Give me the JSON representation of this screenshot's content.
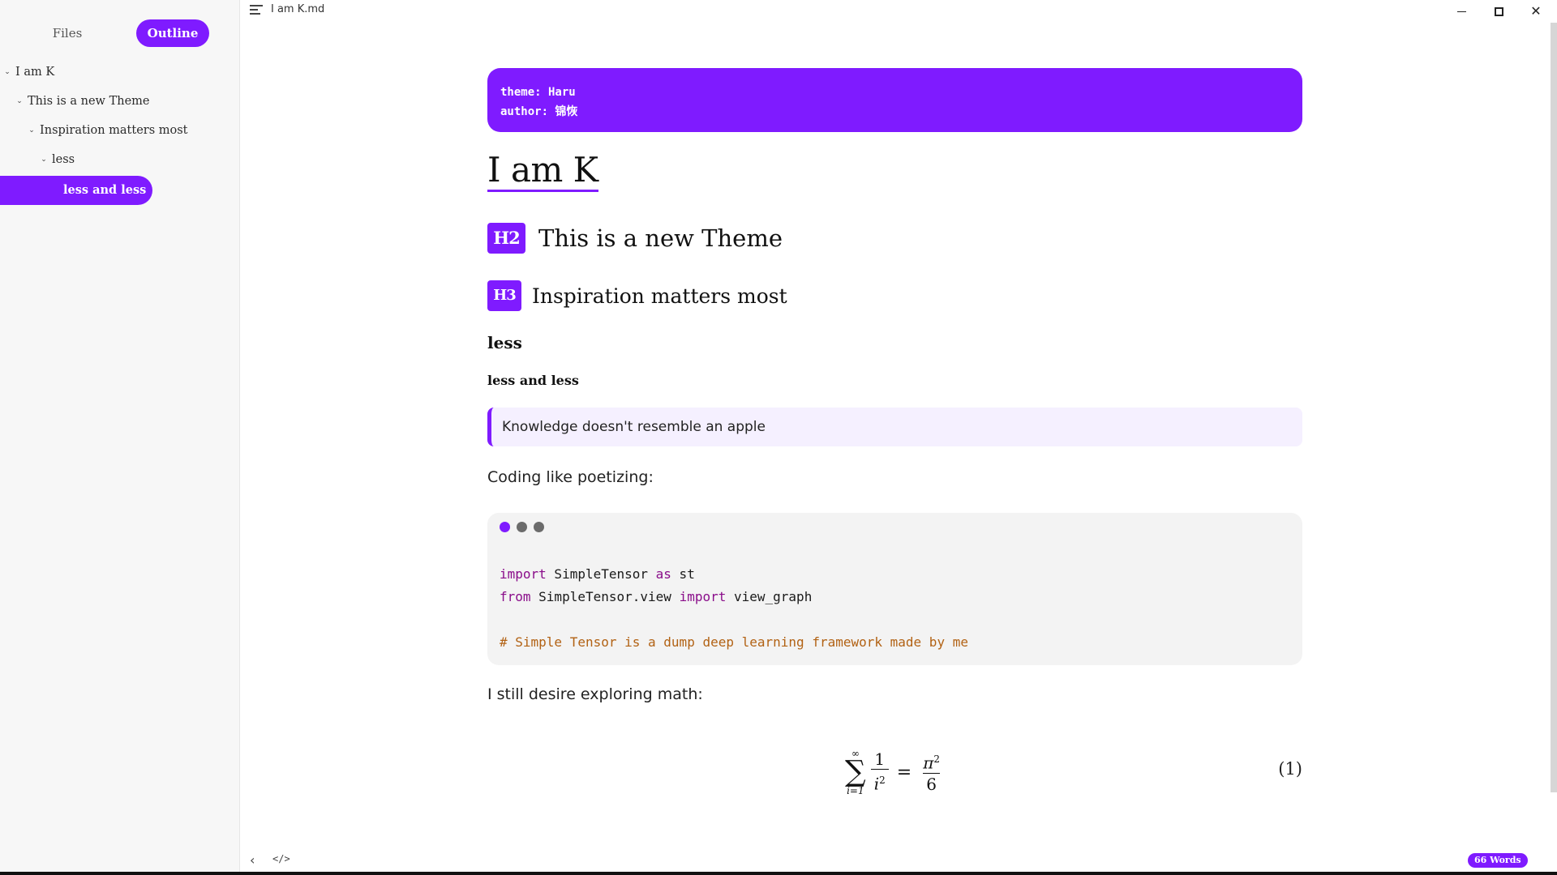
{
  "window": {
    "title": "I am K.md",
    "menu_icon": "menu-icon",
    "controls": [
      "minimize-icon",
      "maximize-icon",
      "close-icon"
    ],
    "close_glyph": "✕"
  },
  "sidebar": {
    "tabs": {
      "files": "Files",
      "outline": "Outline"
    },
    "active_tab": "Outline",
    "outline": [
      {
        "label": "I am K",
        "level": 1,
        "expanded": true
      },
      {
        "label": "This is a new Theme",
        "level": 2,
        "expanded": true
      },
      {
        "label": "Inspiration matters most",
        "level": 3,
        "expanded": true
      },
      {
        "label": "less",
        "level": 4,
        "expanded": true
      },
      {
        "label": "less and less",
        "level": 5,
        "active": true
      }
    ]
  },
  "document": {
    "front_matter": {
      "line1": "theme: Haru",
      "line2": "author: 锦恢"
    },
    "h1": "I am K",
    "h2": {
      "badge": "H2",
      "text": "This is a new Theme"
    },
    "h3": {
      "badge": "H3",
      "text": "Inspiration matters most"
    },
    "h4": "less",
    "h5": "less and less",
    "blockquote": "Knowledge doesn't resemble an apple",
    "para_coding": "Coding like poetizing:",
    "code": {
      "line1": {
        "kw1": "import",
        "t1": " SimpleTensor ",
        "kw2": "as",
        "t2": " st"
      },
      "line2": {
        "kw1": "from",
        "t1": " SimpleTensor.view ",
        "kw2": "import",
        "t2": " view_graph"
      },
      "comment": "# Simple Tensor is a dump deep learning framework made by me"
    },
    "para_math": "I still desire exploring math:",
    "math": {
      "sum_upper": "∞",
      "sum_symbol": "∑",
      "sum_lower": "i=1",
      "lhs_num": "1",
      "lhs_den": "i",
      "lhs_den_exp": "2",
      "equals": "=",
      "rhs_num": "π",
      "rhs_num_exp": "2",
      "rhs_den": "6",
      "eq_number": "(1)"
    }
  },
  "statusbar": {
    "back_glyph": "‹",
    "source_glyph": "</>",
    "word_count": "66 Words"
  },
  "colors": {
    "accent": "#7f1bff",
    "blockquote_bg": "#f5f0ff",
    "code_bg": "#f3f3f3",
    "code_keyword": "#8a0d8a",
    "code_comment": "#b26214"
  }
}
